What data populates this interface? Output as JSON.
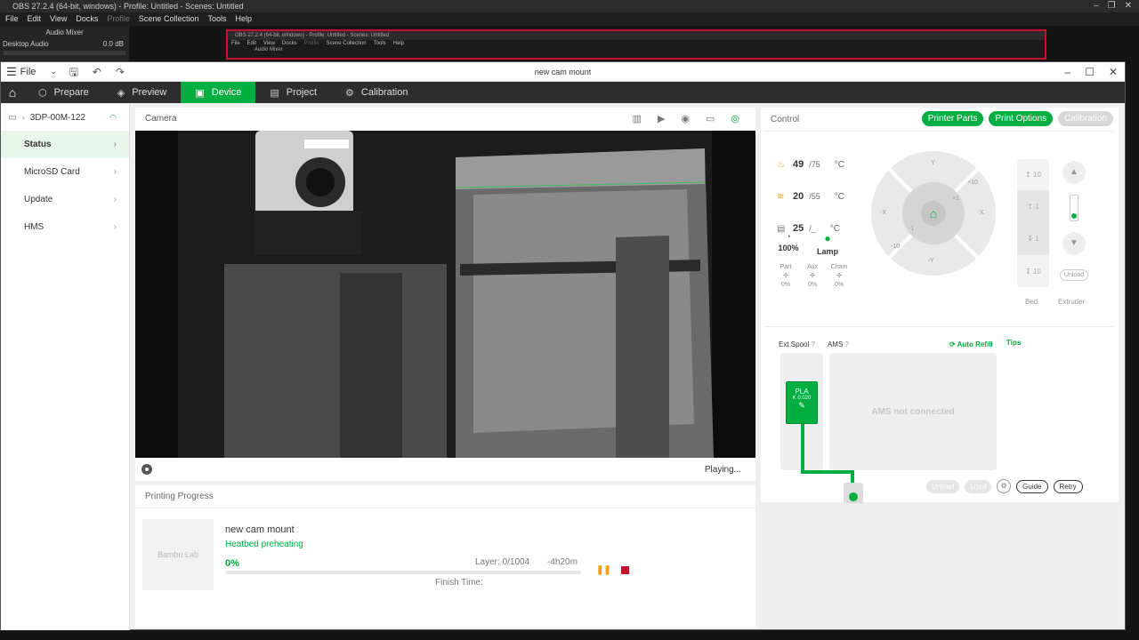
{
  "obs": {
    "title": "OBS 27.2.4 (64-bit, windows) - Profile: Untitled - Scenes: Untitled",
    "menu": [
      "File",
      "Edit",
      "View",
      "Docks",
      "Profile",
      "Scene Collection",
      "Tools",
      "Help"
    ],
    "dock_title": "Audio Mixer",
    "audio_source": "Desktop Audio",
    "audio_level": "0.0 dB",
    "nested_title": "OBS 27.2.4 (64-bit, windows) - Profile: Untitled - Scenes: Untitled",
    "nested_dock": "Audio Mixer"
  },
  "app": {
    "file_label": "File",
    "window_title": "new cam mount"
  },
  "nav": {
    "tabs": [
      {
        "label": "Prepare",
        "icon": "cube-icon"
      },
      {
        "label": "Preview",
        "icon": "layers-icon"
      },
      {
        "label": "Device",
        "icon": "device-icon"
      },
      {
        "label": "Project",
        "icon": "document-icon"
      },
      {
        "label": "Calibration",
        "icon": "gear-icon"
      }
    ],
    "active": "Device"
  },
  "sidebar": {
    "device_name": "3DP-00M-122",
    "items": [
      {
        "label": "Status"
      },
      {
        "label": "MicroSD Card"
      },
      {
        "label": "Update"
      },
      {
        "label": "HMS"
      }
    ]
  },
  "camera": {
    "title": "Camera",
    "status": "Playing..."
  },
  "progress": {
    "title": "Printing Progress",
    "thumb_text": "Bambu Lab",
    "job_name": "new cam mount",
    "state": "Heatbed preheating",
    "percent": "0%",
    "percent_value": 0,
    "layer": "Layer: 0/1004",
    "eta": "-4h20m",
    "finish_label": "Finish Time:"
  },
  "control": {
    "title": "Control",
    "buttons": {
      "parts": "Printer Parts",
      "options": "Print Options",
      "calibration": "Calibration"
    },
    "nozzle": {
      "value": "49",
      "target": "/75",
      "unit": "°C"
    },
    "bed": {
      "value": "20",
      "target": "/55",
      "unit": "°C"
    },
    "chamber": {
      "value": "25",
      "target": "/_",
      "unit": "°C"
    },
    "speed": "100%",
    "lamp": "Lamp",
    "fans": [
      {
        "name": "Part",
        "value": "0%"
      },
      {
        "name": "Aux",
        "value": "0%"
      },
      {
        "name": "Cham",
        "value": "0%"
      }
    ],
    "joystick": {
      "y": "Y",
      "neg_y": "-Y",
      "x": "X",
      "neg_x": "-X",
      "p10": "+10",
      "p1": "+1",
      "m1": "-1",
      "m10": "-10"
    },
    "bed_steps": [
      "10",
      "1",
      "1",
      "10"
    ],
    "bed_label": "Bed",
    "extruder_label": "Extruder",
    "unload_small": "Unload",
    "ext_spool": "Ext Spool",
    "ams": "AMS",
    "auto_refill": "Auto Refill",
    "tips": "Tips",
    "spool_material": "PLA",
    "spool_k": "K 0.020",
    "ams_status": "AMS not connected",
    "ams_buttons": {
      "unload": "Unload",
      "load": "Load",
      "guide": "Guide",
      "retry": "Retry"
    }
  },
  "colors": {
    "accent": "#00ae42",
    "nav_bg": "#2d2d2d",
    "stop": "#c8102e",
    "pause": "#f59e0b"
  }
}
